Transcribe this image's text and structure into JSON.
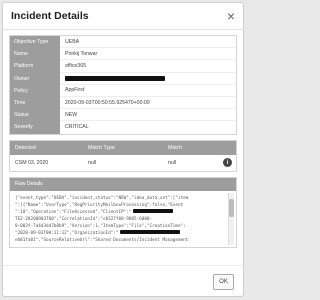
{
  "modal": {
    "title": "Incident Details",
    "close_glyph": "×",
    "ok_label": "OK"
  },
  "details": [
    {
      "key": "Objective Type",
      "value": "UEBA"
    },
    {
      "key": "Name",
      "value": "Prinkij Tonwar"
    },
    {
      "key": "Platform",
      "value": "office365"
    },
    {
      "key": "Owner",
      "value": ""
    },
    {
      "key": "Policy",
      "value": "AppFirst"
    },
    {
      "key": "Time",
      "value": "2020-09-03T00:50:55.925470+00:00"
    },
    {
      "key": "Status",
      "value": "NEW"
    },
    {
      "key": "Severity",
      "value": "CRITICAL"
    }
  ],
  "detection": {
    "headers": [
      "Detected",
      "Match Type",
      "Match"
    ],
    "rows": [
      {
        "detected": "CSM 03, 2020",
        "match_type": "null",
        "match": "null",
        "info_glyph": "i"
      }
    ]
  },
  "raw": {
    "title": "Raw Details",
    "lines": [
      "{\"event_type\":\"UEBA\",\"incident_status\":\"NEW\",\"idea_data_set\":[\"item",
      "\":[{\"Name\":\"UserType\",\"RegPriorityMailboxProcessing\":false,\"Event",
      "\":10\",\"Operation\":\"FileAccessed\",\"ClientIP\":\"",
      "TE2-20200903T00\",\"CorrelationId\":\"c0327f08-9885-6000-",
      "0-003f-7a4d3dd7b8b9\",\"Version\":1,\"ItemType\":\"File\",\"CreationTime\":",
      "\"2020-09-03T00:11:12\",\"OrganizationId\":\"",
      "eb81fa01\",\"SourceRelativeUrl\":\"Shared Documents/Incident Management"
    ]
  },
  "colors": {
    "header_bg": "#9d9d9d",
    "redaction": "#111111"
  }
}
